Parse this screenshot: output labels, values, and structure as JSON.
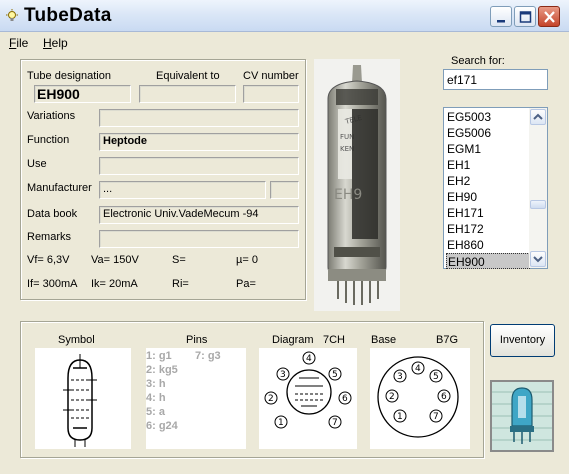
{
  "window": {
    "title": "TubeData"
  },
  "menu": {
    "file": "F",
    "file_rest": "ile",
    "help": "H",
    "help_rest": "elp"
  },
  "main": {
    "tube_designation_label": "Tube designation",
    "tube_designation": "EH900",
    "equivalent_label": "Equivalent to",
    "equivalent_value": "",
    "cv_label": "CV number",
    "cv_value": "",
    "variations_label": "Variations",
    "variations_value": "",
    "function_label": "Function",
    "function_value": "Heptode",
    "use_label": "Use",
    "use_value": "",
    "manufacturer_label": "Manufacturer",
    "manufacturer_value": "...",
    "databook_label": "Data book",
    "databook_value": "Electronic Univ.VadeMecum -94",
    "remarks_label": "Remarks",
    "remarks_value": "",
    "vf": "Vf= 6,3V",
    "va": "Va= 150V",
    "s": "S=",
    "mu": "µ=    0",
    "if": "If= 300mA",
    "ik": "Ik= 20mA",
    "ri": "Ri=",
    "pa": "Pa="
  },
  "search": {
    "label": "Search for:",
    "value": "ef171"
  },
  "tube_list": {
    "items": [
      "EG5003",
      "EG5006",
      "EGM1",
      "EH1",
      "EH2",
      "EH90",
      "EH171",
      "EH172",
      "EH860",
      "EH900"
    ],
    "selected": "EH900"
  },
  "buttons": {
    "inventory": "Inventory"
  },
  "bottom": {
    "symbol_label": "Symbol",
    "pins_label": "Pins",
    "diagram_label": "Diagram",
    "diagram_code": "7CH",
    "base_label": "Base",
    "base_code": "B7G",
    "pins": [
      "1: g1",
      "2: kg5",
      "3: h",
      "4: h",
      "5: a",
      "6: g24"
    ],
    "pin7": "7: g3",
    "diagram_numbers": [
      "1",
      "2",
      "3",
      "4",
      "5",
      "6",
      "7"
    ]
  },
  "colors": {
    "selection": "#c8c8c8",
    "titlebar": "#dbe7f7",
    "close_button": "#c4442a",
    "pins_text": "#a8a8a8"
  }
}
